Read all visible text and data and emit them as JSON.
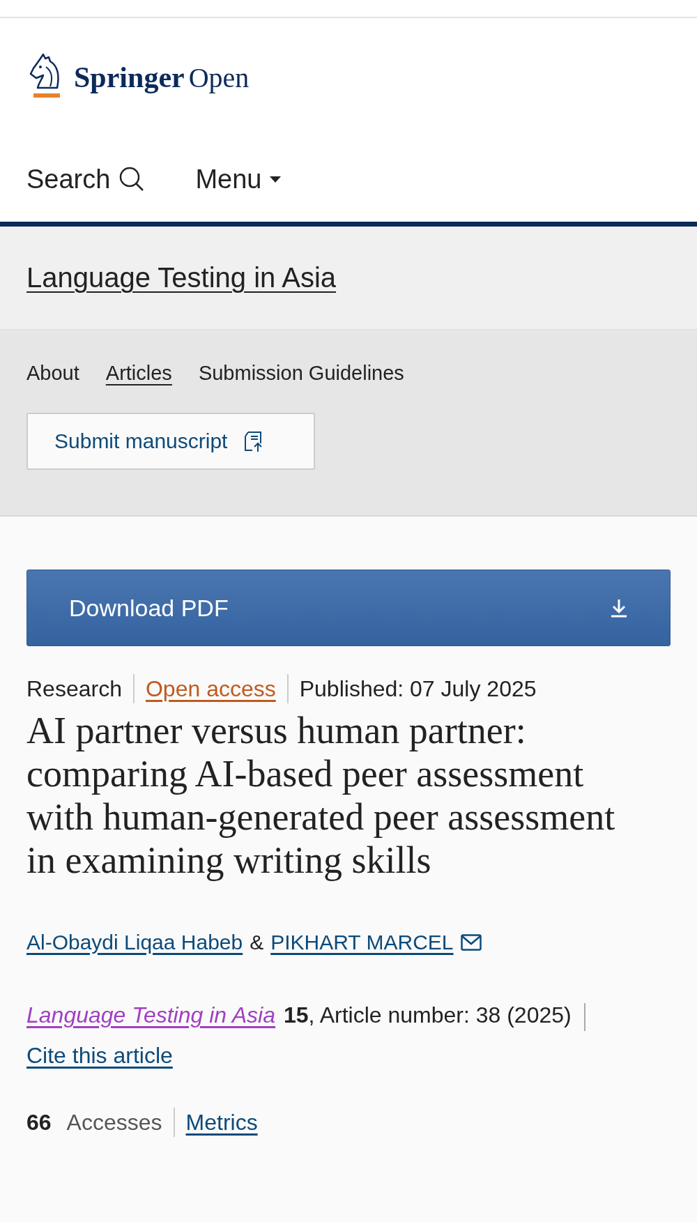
{
  "header": {
    "logo": {
      "brand": "Springer",
      "suffix": "Open"
    },
    "search": {
      "label": "Search"
    },
    "menu": {
      "label": "Menu"
    }
  },
  "journal": {
    "title": "Language Testing in Asia"
  },
  "journal_nav": {
    "items": [
      {
        "label": "About",
        "selected": false
      },
      {
        "label": "Articles",
        "selected": true
      },
      {
        "label": "Submission Guidelines",
        "selected": false
      }
    ],
    "submit_button": {
      "label": "Submit manuscript"
    }
  },
  "download_button": {
    "label": "Download PDF"
  },
  "article": {
    "type": "Research",
    "access": "Open access",
    "published": "Published: 07 July 2025",
    "title": "AI partner versus human partner: comparing AI-based peer assessment with human-generated peer assessment in examining writing skills",
    "authors": [
      {
        "name": "Al-Obaydi Liqaa Habeb",
        "contact": false
      },
      {
        "name": "PIKHART MARCEL",
        "contact": true
      }
    ],
    "author_separator": "&",
    "citation": {
      "journal": "Language Testing in Asia",
      "details": "**15**, Article number: 38 (2025)",
      "cite_link": "Cite this article"
    },
    "metrics": {
      "count": "66",
      "label": "Accesses",
      "link": "Metrics"
    }
  }
}
